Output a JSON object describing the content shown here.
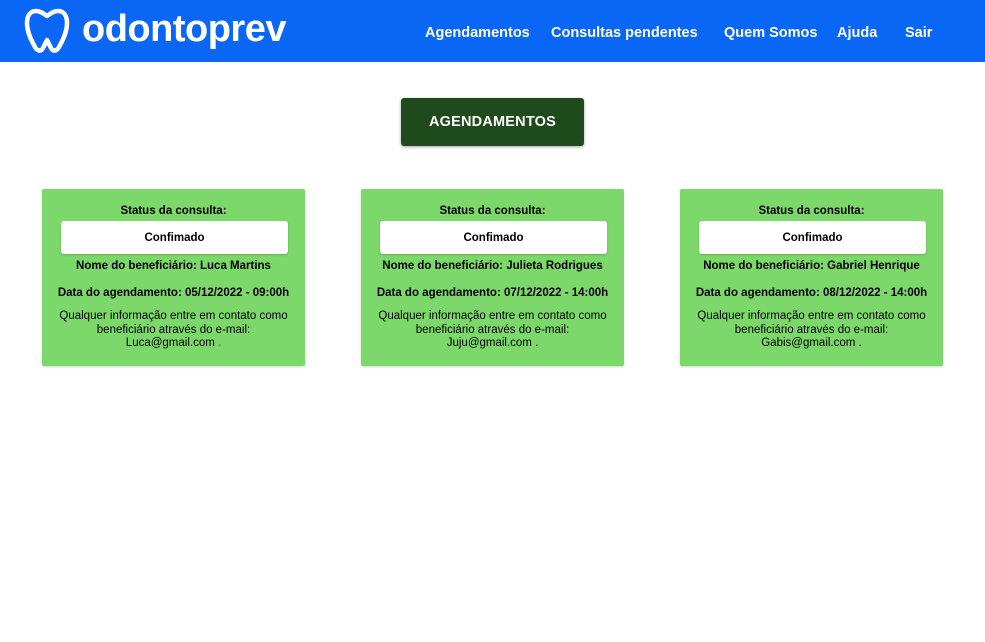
{
  "header": {
    "brand": "odontoprev",
    "logo_icon": "tooth-icon",
    "background": "#0a66f5",
    "nav": [
      {
        "label": "Agendamentos"
      },
      {
        "label": "Consultas pendentes"
      },
      {
        "label": "Quem Somos"
      },
      {
        "label": "Ajuda"
      },
      {
        "label": "Sair"
      }
    ]
  },
  "page": {
    "title_button": "AGENDAMENTOS",
    "title_button_color": "#1f4a1c",
    "card_color": "#7cd86a"
  },
  "appointments": [
    {
      "status_label": "Status da consulta:",
      "status": "Confimado",
      "beneficiary": "Nome do beneficiário: Luca Martins",
      "date": "Data do agendamento: 05/12/2022 - 09:00h",
      "contact_text": "Qualquer informação entre em contato como beneficiário através do e-mail:",
      "email_line": "Luca@gmail.com ."
    },
    {
      "status_label": "Status da consulta:",
      "status": "Confimado",
      "beneficiary": "Nome do beneficiário: Julieta Rodrigues",
      "date": "Data do agendamento: 07/12/2022 - 14:00h",
      "contact_text": "Qualquer informação entre em contato como beneficiário através do e-mail:",
      "email_line": "Juju@gmail.com ."
    },
    {
      "status_label": "Status da consulta:",
      "status": "Confimado",
      "beneficiary": "Nome do beneficiário: Gabriel Henrique",
      "date": "Data do agendamento: 08/12/2022 - 14:00h",
      "contact_text": "Qualquer informação entre em contato como beneficiário através do e-mail:",
      "email_line": "Gabis@gmail.com ."
    }
  ]
}
